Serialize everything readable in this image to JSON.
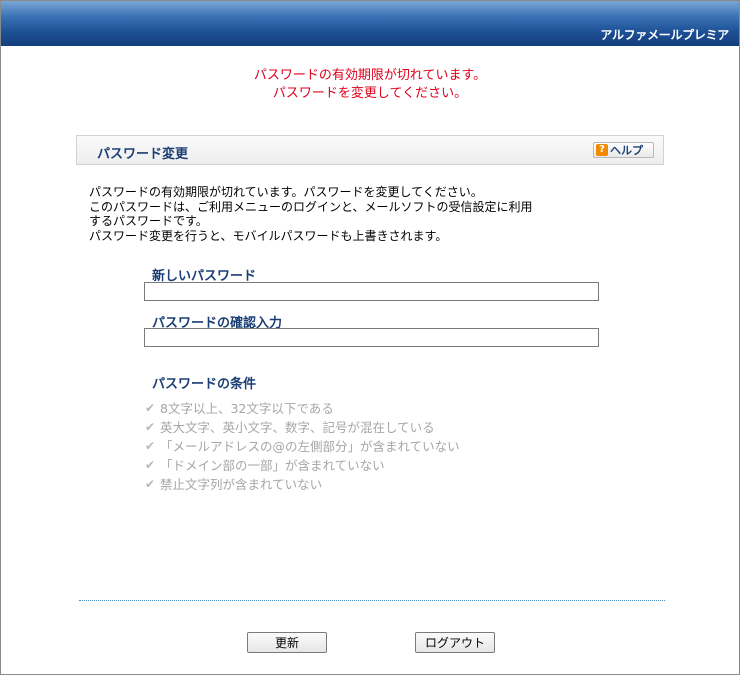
{
  "header": {
    "brand": "アルファメールプレミア",
    "colors": {
      "gradient_top": "#7aa6d4",
      "gradient_bottom": "#143e7c"
    }
  },
  "alert": {
    "lines": [
      "パスワードの有効期限が切れています。",
      "パスワードを変更してください。"
    ],
    "color": "#e0001b"
  },
  "section": {
    "title": "パスワード変更",
    "help_label": "ヘルプ",
    "help_icon": "question-icon"
  },
  "description": {
    "lines": [
      "パスワードの有効期限が切れています。パスワードを変更してください。",
      "このパスワードは、ご利用メニューのログインと、メールソフトの受信設定に利用",
      "するパスワードです。",
      "パスワード変更を行うと、モバイルパスワードも上書きされます。"
    ]
  },
  "form": {
    "new_password": {
      "label": "新しいパスワード",
      "value": "",
      "placeholder": ""
    },
    "confirm_password": {
      "label": "パスワードの確認入力",
      "value": "",
      "placeholder": ""
    }
  },
  "conditions": {
    "title": "パスワードの条件",
    "icon": "check-icon",
    "items": [
      "8文字以上、32文字以下である",
      "英大文字、英小文字、数字、記号が混在している",
      "「メールアドレスの@の左側部分」が含まれていない",
      "「ドメイン部の一部」が含まれていない",
      "禁止文字列が含まれていない"
    ]
  },
  "actions": {
    "update_label": "更新",
    "logout_label": "ログアウト"
  }
}
